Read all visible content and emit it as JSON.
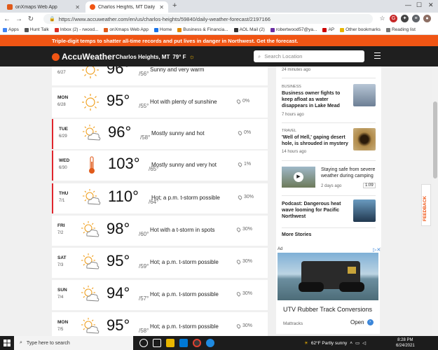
{
  "browser": {
    "tabs": [
      {
        "title": "onXmaps Web App",
        "fav_color": "#e05a1a"
      },
      {
        "title": "Charlos Heights, MT Daily Weathe",
        "fav_color": "#f05514"
      }
    ],
    "url": "https://www.accuweather.com/en/us/charlos-heights/59840/daily-weather-forecast/2197166",
    "bookmarks": [
      {
        "label": "Apps",
        "color": "#4285f4"
      },
      {
        "label": "Hunt Talk",
        "color": "#555555"
      },
      {
        "label": "Inbox (2) - rwood...",
        "color": "#d93025"
      },
      {
        "label": "onXmaps Web App",
        "color": "#e05a1a"
      },
      {
        "label": "Home",
        "color": "#1a73e8"
      },
      {
        "label": "Business & Financia...",
        "color": "#e08a00"
      },
      {
        "label": "AOL Mail (2)",
        "color": "#333333"
      },
      {
        "label": "robertwood57@ya...",
        "color": "#6b2fa3"
      },
      {
        "label": "AP",
        "color": "#cc0000"
      },
      {
        "label": "Other bookmarks",
        "color": "#e8b600"
      },
      {
        "label": "Reading list",
        "color": "#777777"
      }
    ]
  },
  "site": {
    "alert": "Triple-digit temps to shatter all-time records and put lives in danger in Northwest. Get the forecast.",
    "logo": "AccuWeather",
    "location": "Charlos Heights, MT",
    "current_temp": "79° F",
    "search_placeholder": "Search Location"
  },
  "forecast": [
    {
      "day": "",
      "date": "6/27",
      "hi": "96°",
      "lo": "/56°",
      "phrase": "Sunny and very warm",
      "precip": "",
      "icon": "sun",
      "alert": false
    },
    {
      "day": "MON",
      "date": "6/28",
      "hi": "95°",
      "lo": "/55°",
      "phrase": "Hot with plenty of sunshine",
      "precip": "0%",
      "icon": "sun",
      "alert": false
    },
    {
      "day": "TUE",
      "date": "6/29",
      "hi": "96°",
      "lo": "/58°",
      "phrase": "Mostly sunny and hot",
      "precip": "0%",
      "icon": "sun-cloud",
      "alert": true
    },
    {
      "day": "WED",
      "date": "6/30",
      "hi": "103°",
      "lo": "/65°",
      "phrase": "Mostly sunny and very hot",
      "precip": "1%",
      "icon": "thermometer",
      "alert": true
    },
    {
      "day": "THU",
      "date": "7/1",
      "hi": "110°",
      "lo": "/64°",
      "phrase": "Hot; a p.m. t-storm possible",
      "precip": "30%",
      "icon": "sun-cloud",
      "alert": true
    },
    {
      "day": "FRI",
      "date": "7/2",
      "hi": "98°",
      "lo": "/60°",
      "phrase": "Hot with a t-storm in spots",
      "precip": "30%",
      "icon": "sun-cloud",
      "alert": false
    },
    {
      "day": "SAT",
      "date": "7/3",
      "hi": "95°",
      "lo": "/59°",
      "phrase": "Hot; a p.m. t-storm possible",
      "precip": "30%",
      "icon": "sun-cloud",
      "alert": false
    },
    {
      "day": "SUN",
      "date": "7/4",
      "hi": "94°",
      "lo": "/57°",
      "phrase": "Hot; a p.m. t-storm possible",
      "precip": "30%",
      "icon": "sun-cloud",
      "alert": false
    },
    {
      "day": "MON",
      "date": "7/5",
      "hi": "95°",
      "lo": "/58°",
      "phrase": "Hot; a p.m. t-storm possible",
      "precip": "30%",
      "icon": "sun-cloud",
      "alert": false
    }
  ],
  "rail": {
    "first_timestamp": "24 minutes ago",
    "stories": [
      {
        "category": "BUSINESS",
        "headline": "Business owner fights to keep afloat as water disappears in Lake Mead",
        "time": "7 hours ago",
        "thumb_color": "#8a9fb5"
      },
      {
        "category": "TRAVEL",
        "headline": "'Well of Hell,' gaping desert hole, is shrouded in mystery",
        "time": "14 hours ago",
        "thumb_color": "#8a6a3a"
      },
      {
        "category": "",
        "headline": "Staying safe from severe weather during camping",
        "time": "2 days ago",
        "duration": "1:09",
        "thumb_color": "#7d8c6a"
      },
      {
        "category": "",
        "headline": "Podcast: Dangerous heat wave looming for Pacific Northwest",
        "time": "",
        "thumb_color": "#3d6d8f"
      }
    ],
    "more": "More Stories"
  },
  "ad": {
    "tag": "Ad",
    "title": "UTV Rubber Track Conversions",
    "source": "Mattracks",
    "cta": "Open"
  },
  "feedback": "FEEDBACK",
  "taskbar": {
    "search": "Type here to search",
    "weather": "62°F  Partly sunny",
    "time": "8:28 PM",
    "date": "6/24/2021"
  }
}
